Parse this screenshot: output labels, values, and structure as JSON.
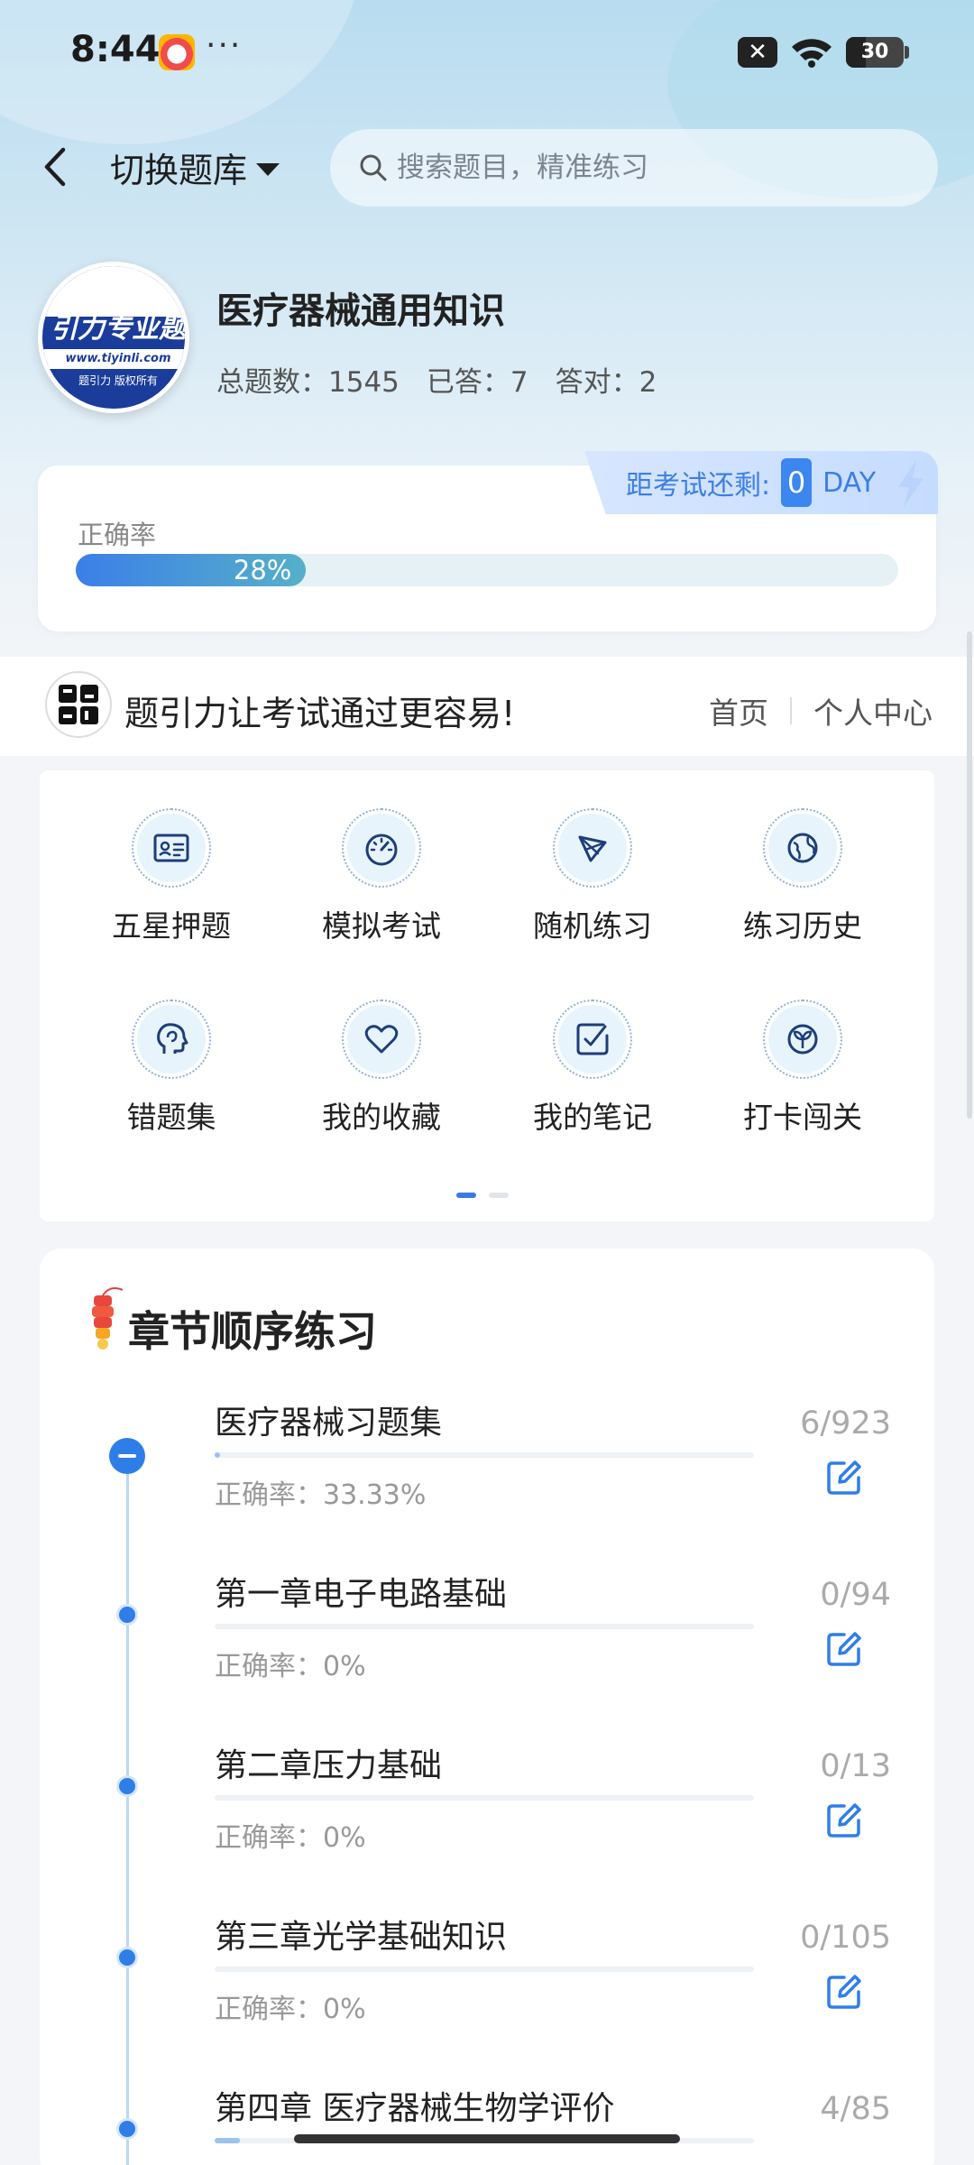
{
  "status_bar": {
    "time": "8:44",
    "dots": "···",
    "battery": "30",
    "sim": "✕"
  },
  "nav": {
    "switch_bank": "切换题库",
    "search_placeholder": "搜索题目，精准练习"
  },
  "course": {
    "logo_text": "引力专业题",
    "logo_url_text": "www.tiyinli.com",
    "logo_footer": "题引力 版权所有",
    "title": "医疗器械通用知识",
    "total_label": "总题数：1545",
    "answered_label": "已答：7",
    "correct_label": "答对：2"
  },
  "accuracy_card": {
    "exam_countdown_label": "距考试还剩:",
    "exam_days": "0",
    "day_unit": "DAY",
    "accuracy_label": "正确率",
    "accuracy_percent_text": "28%",
    "accuracy_value": 28
  },
  "promo": {
    "logo_text": "题引力",
    "slogan": "题引力让考试通过更容易!",
    "links": [
      "首页",
      "个人中心"
    ]
  },
  "menu": [
    {
      "label": "五星押题",
      "icon": "id-card-icon"
    },
    {
      "label": "模拟考试",
      "icon": "gauge-icon"
    },
    {
      "label": "随机练习",
      "icon": "shuffle-icon"
    },
    {
      "label": "练习历史",
      "icon": "globe-icon"
    },
    {
      "label": "错题集",
      "icon": "head-icon"
    },
    {
      "label": "我的收藏",
      "icon": "heart-icon"
    },
    {
      "label": "我的笔记",
      "icon": "note-check-icon"
    },
    {
      "label": "打卡闯关",
      "icon": "sprout-icon"
    }
  ],
  "pager": {
    "pages": 2,
    "active": 0
  },
  "chapters_section": {
    "title": "章节顺序练习",
    "items": [
      {
        "name": "医疗器械习题集",
        "accuracy": "正确率：33.33%",
        "count": "6/923",
        "progress": 0.0065,
        "expanded": true
      },
      {
        "name": "第一章电子电路基础",
        "accuracy": "正确率：0%",
        "count": "0/94",
        "progress": 0,
        "expanded": false
      },
      {
        "name": "第二章压力基础",
        "accuracy": "正确率：0%",
        "count": "0/13",
        "progress": 0,
        "expanded": false
      },
      {
        "name": "第三章光学基础知识",
        "accuracy": "正确率：0%",
        "count": "0/105",
        "progress": 0,
        "expanded": false
      },
      {
        "name": "第四章 医疗器械生物学评价",
        "accuracy": "",
        "count": "4/85",
        "progress": 0.047,
        "expanded": false
      }
    ]
  },
  "colors": {
    "accent": "#3a7be6",
    "accuracy_fill_end": "#56b0c8",
    "hero_top": "#b9dcf0"
  }
}
